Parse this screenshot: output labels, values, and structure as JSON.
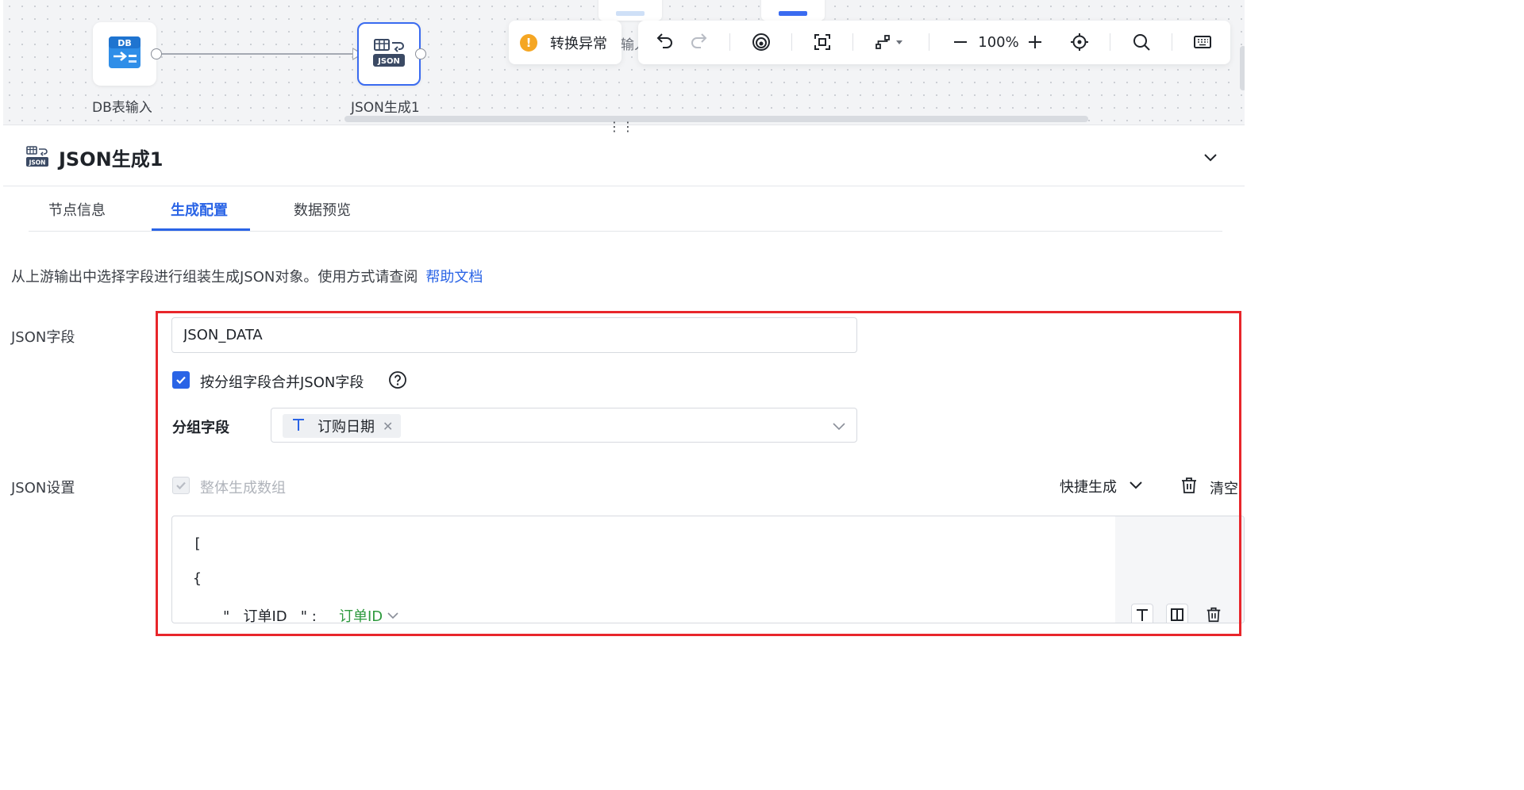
{
  "canvas": {
    "nodes": [
      {
        "label": "DB表输入",
        "icon": "db-table-input-icon",
        "badge": "DB"
      },
      {
        "label": "JSON生成1",
        "icon": "json-generate-icon",
        "badge": "JSON"
      }
    ],
    "warning": {
      "text": "转换异常",
      "icon": "warning-icon"
    },
    "toolbar": {
      "clipped_text": "输入",
      "zoom": "100%",
      "icons": [
        "undo-icon",
        "redo-icon",
        "preview-icon",
        "fit-view-icon",
        "layout-icon",
        "zoom-out-icon",
        "zoom-in-icon",
        "locate-icon",
        "search-icon",
        "keyboard-icon"
      ]
    },
    "resize_handle": "⋮⋮"
  },
  "panel": {
    "title": "JSON生成1",
    "title_icon_badge": "JSON",
    "tabs": [
      {
        "label": "节点信息",
        "active": false
      },
      {
        "label": "生成配置",
        "active": true
      },
      {
        "label": "数据预览",
        "active": false
      }
    ],
    "description": "从上游输出中选择字段进行组装生成JSON对象。使用方式请查阅",
    "help_link": "帮助文档",
    "json_field": {
      "label": "JSON字段",
      "value": "JSON_DATA"
    },
    "merge_checkbox": {
      "label": "按分组字段合并JSON字段",
      "checked": true
    },
    "group_field": {
      "label": "分组字段",
      "selected_tags": [
        {
          "text": "订购日期",
          "type_icon": "text-type-icon"
        }
      ]
    },
    "json_settings": {
      "label": "JSON设置",
      "array_checkbox": {
        "label": "整体生成数组",
        "checked": true,
        "disabled": true
      },
      "quick_generate": "快捷生成",
      "clear": "清空",
      "code_lines": [
        "[",
        "{"
      ],
      "entry": {
        "key": "\"   订单ID   \" :",
        "value": "订单ID"
      }
    }
  },
  "colors": {
    "accent": "#2a64e6",
    "warning": "#f5a623",
    "highlight": "#e8262b",
    "value_green": "#2e9a3e"
  }
}
